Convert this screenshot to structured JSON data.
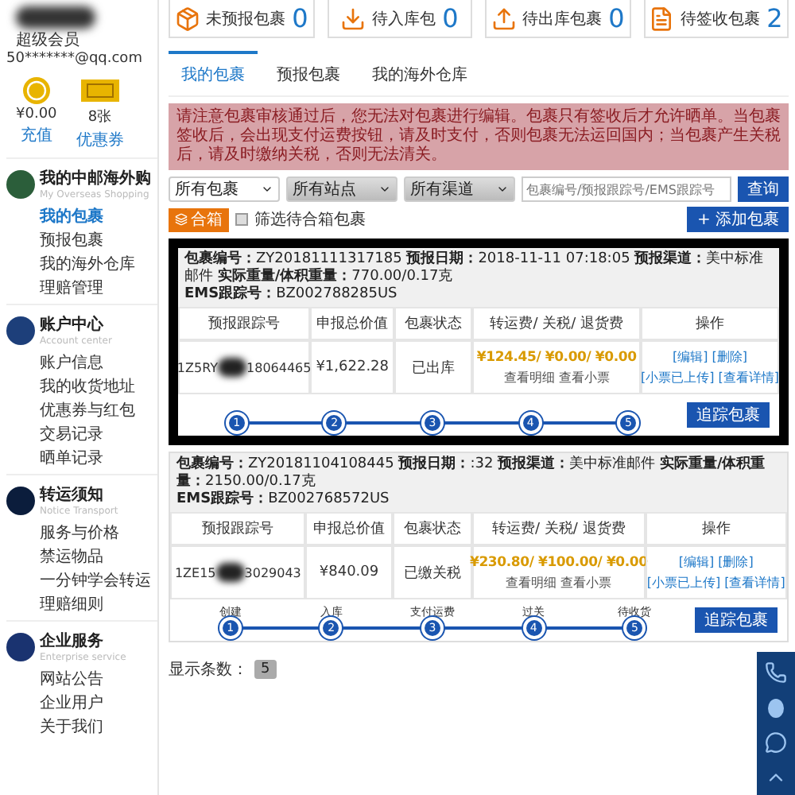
{
  "user": {
    "level": "超级会员",
    "email": "50*******@qq.com",
    "wallet": [
      {
        "kind": "coin",
        "value": "¥0.00",
        "link": "充值"
      },
      {
        "kind": "ticket",
        "value": "8张",
        "link": "优惠券"
      }
    ]
  },
  "sidebar": [
    {
      "kind": "shopping",
      "title": "我的中邮海外购",
      "subtitle": "My Overseas Shopping",
      "items": [
        {
          "label": "我的包裹",
          "selected": true
        },
        {
          "label": "预报包裹",
          "selected": false
        },
        {
          "label": "我的海外仓库",
          "selected": false
        },
        {
          "label": "理赔管理",
          "selected": false
        }
      ]
    },
    {
      "kind": "account",
      "title": "账户中心",
      "subtitle": "Account center",
      "items": [
        {
          "label": "账户信息",
          "selected": false
        },
        {
          "label": "我的收货地址",
          "selected": false
        },
        {
          "label": "优惠券与红包",
          "selected": false
        },
        {
          "label": "交易记录",
          "selected": false
        },
        {
          "label": "晒单记录",
          "selected": false
        }
      ]
    },
    {
      "kind": "notice",
      "title": "转运须知",
      "subtitle": "Notice Transport",
      "items": [
        {
          "label": "服务与价格",
          "selected": false
        },
        {
          "label": "禁运物品",
          "selected": false
        },
        {
          "label": "一分钟学会转运",
          "selected": false
        },
        {
          "label": "理赔细则",
          "selected": false
        }
      ]
    },
    {
      "kind": "enterprise",
      "title": "企业服务",
      "subtitle": "Enterprise service",
      "items": [
        {
          "label": "网站公告",
          "selected": false
        },
        {
          "label": "企业用户",
          "selected": false
        },
        {
          "label": "关于我们",
          "selected": false
        }
      ]
    }
  ],
  "stats": [
    {
      "kind": "box",
      "label": "未预报包裹",
      "count": "0"
    },
    {
      "kind": "download",
      "label": "待入库包",
      "count": "0"
    },
    {
      "kind": "upload",
      "label": "待出库包裹",
      "count": "0"
    },
    {
      "kind": "doc",
      "label": "待签收包裹",
      "count": "2"
    }
  ],
  "tabs": [
    {
      "label": "我的包裹",
      "selected": true
    },
    {
      "label": "预报包裹",
      "selected": false
    },
    {
      "label": "我的海外仓库",
      "selected": false
    }
  ],
  "notice": "请注意包裹审核通过后，您无法对包裹进行编辑。包裹只有签收后才允许晒单。当包裹签收后，会出现支付运费按钮，请及时支付，否则包裹无法运回国内；当包裹产生关税后，请及时缴纳关税，否则无法清关。",
  "filters": {
    "selects": [
      "所有包裹",
      "所有站点",
      "所有渠道"
    ],
    "search": {
      "placeholder": "包裹编号/预报跟踪号/EMS跟踪号"
    },
    "search_button": "查询",
    "add_button": "+ 添加包裹",
    "merge_button": "合箱",
    "merge_filter": {
      "label": "筛选待合箱包裹",
      "checked": false
    }
  },
  "parcels": [
    {
      "highlighted": true,
      "header": [
        {
          "label": "包裹编号：",
          "value": "ZY20181111317185"
        },
        {
          "label": "预报日期：",
          "value": "2018-11-11 07:18:05"
        },
        {
          "label": "预报渠道：",
          "value": "美中标准邮件"
        },
        {
          "label": "实际重量/体积重量：",
          "value": "770.00/0.17克"
        }
      ],
      "ems": {
        "label": "EMS跟踪号：",
        "value": "BZ002788285US"
      },
      "columns": [
        "预报跟踪号",
        "申报总价值",
        "包裹状态",
        "转运费/ 关税/ 退货费",
        "操作"
      ],
      "tracking_start": "1Z5RY",
      "tracking_end": "18064465",
      "declared": "¥1,622.28",
      "status": "已出库",
      "fees": "¥124.45/ ¥0.00/ ¥0.00",
      "fee_links": [
        "查看明细",
        "查看小票"
      ],
      "ops": [
        "[编辑]",
        "[删除]",
        "[小票已上传]",
        "[查看详情]"
      ],
      "steps": [
        {
          "number": "1"
        },
        {
          "number": "2"
        },
        {
          "number": "3"
        },
        {
          "number": "4"
        },
        {
          "number": "5"
        }
      ],
      "buttons": [
        "追踪包裹"
      ]
    },
    {
      "highlighted": false,
      "header": [
        {
          "label": "包裹编号：",
          "value": "ZY20181104108445"
        },
        {
          "label": "预报日期：",
          "value": ":32"
        },
        {
          "label": "预报渠道：",
          "value": "美中标准邮件"
        },
        {
          "label": "实际重量/体积重量：",
          "value": "2150.00/0.17克"
        }
      ],
      "ems": {
        "label": "EMS跟踪号：",
        "value": "BZ002768572US"
      },
      "columns": [
        "预报跟踪号",
        "申报总价值",
        "包裹状态",
        "转运费/ 关税/ 退货费",
        "操作"
      ],
      "tracking_start": "1ZE15",
      "tracking_end": "3029043",
      "declared": "¥840.09",
      "status": "已缴关税",
      "fees": "¥230.80/ ¥100.00/ ¥0.00",
      "fee_links": [
        "查看明细",
        "查看小票"
      ],
      "ops": [
        "[编辑]",
        "[删除]",
        "[小票已上传]",
        "[查看详情]"
      ],
      "steps": [
        {
          "number": "1",
          "label": "创建"
        },
        {
          "number": "2",
          "label": "入库"
        },
        {
          "number": "3",
          "label": "支付运费"
        },
        {
          "number": "4",
          "label": "过关"
        },
        {
          "number": "5",
          "label": "待收货"
        }
      ],
      "buttons": [
        "追踪包裹"
      ]
    }
  ],
  "pager": {
    "label": "显示条数：",
    "value": "5"
  }
}
